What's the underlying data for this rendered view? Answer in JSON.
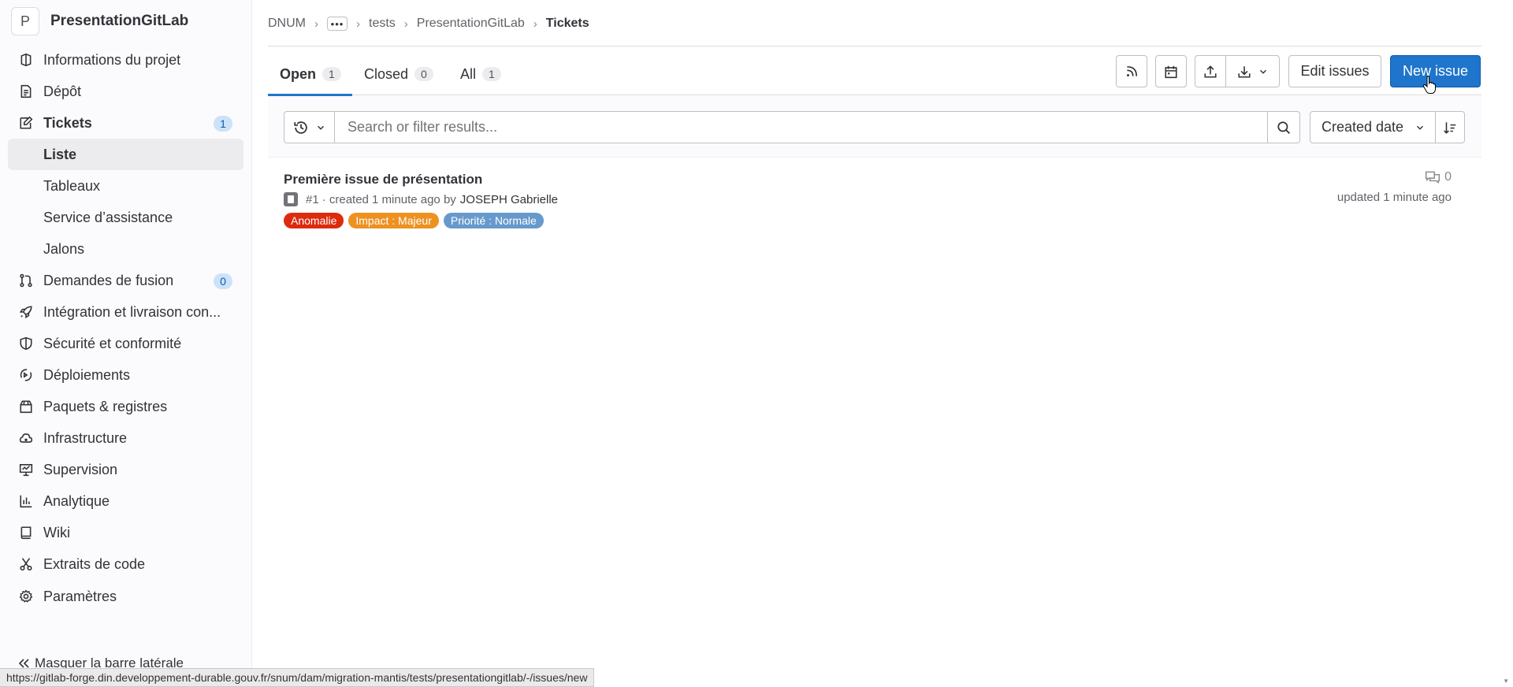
{
  "project": {
    "avatar_letter": "P",
    "name": "PresentationGitLab"
  },
  "sidebar": {
    "items": [
      {
        "label": "Informations du projet",
        "icon": "project-icon"
      },
      {
        "label": "Dépôt",
        "icon": "document-icon"
      },
      {
        "label": "Tickets",
        "icon": "issues-icon",
        "count": "1"
      },
      {
        "label": "Liste"
      },
      {
        "label": "Tableaux"
      },
      {
        "label": "Service d’assistance"
      },
      {
        "label": "Jalons"
      },
      {
        "label": "Demandes de fusion",
        "icon": "merge-request-icon",
        "count": "0"
      },
      {
        "label": "Intégration et livraison con...",
        "icon": "rocket-icon"
      },
      {
        "label": "Sécurité et conformité",
        "icon": "shield-icon"
      },
      {
        "label": "Déploiements",
        "icon": "deployments-icon"
      },
      {
        "label": "Paquets & registres",
        "icon": "package-icon"
      },
      {
        "label": "Infrastructure",
        "icon": "cloud-icon"
      },
      {
        "label": "Supervision",
        "icon": "monitor-icon"
      },
      {
        "label": "Analytique",
        "icon": "chart-icon"
      },
      {
        "label": "Wiki",
        "icon": "book-icon"
      },
      {
        "label": "Extraits de code",
        "icon": "snippet-icon"
      },
      {
        "label": "Paramètres",
        "icon": "settings-icon"
      }
    ],
    "hide_label": "Masquer la barre latérale"
  },
  "breadcrumb": {
    "root": "DNUM",
    "ellipsis": "•••",
    "group": "tests",
    "project": "PresentationGitLab",
    "current": "Tickets"
  },
  "tabs": [
    {
      "label": "Open",
      "count": "1"
    },
    {
      "label": "Closed",
      "count": "0"
    },
    {
      "label": "All",
      "count": "1"
    }
  ],
  "actions": {
    "edit_issues": "Edit issues",
    "new_issue": "New issue"
  },
  "filter": {
    "placeholder": "Search or filter results...",
    "sort_label": "Created date"
  },
  "issue": {
    "title": "Première issue de présentation",
    "reference": "#1",
    "created_text": "· created 1 minute ago by",
    "author": "JOSEPH Gabrielle",
    "comments": "0",
    "updated": "updated 1 minute ago",
    "labels": [
      {
        "text": "Anomalie",
        "color": "#dd2b0e"
      },
      {
        "text": "Impact : Majeur",
        "color": "#ed9121"
      },
      {
        "text": "Priorité : Normale",
        "color": "#6699cc"
      }
    ]
  },
  "status_url": "https://gitlab-forge.din.developpement-durable.gouv.fr/snum/dam/migration-mantis/tests/presentationgitlab/-/issues/new",
  "colors": {
    "accent": "#1f75cb",
    "sidebar_bg": "#fbfafd",
    "badge_bg": "#cbe2f9"
  }
}
